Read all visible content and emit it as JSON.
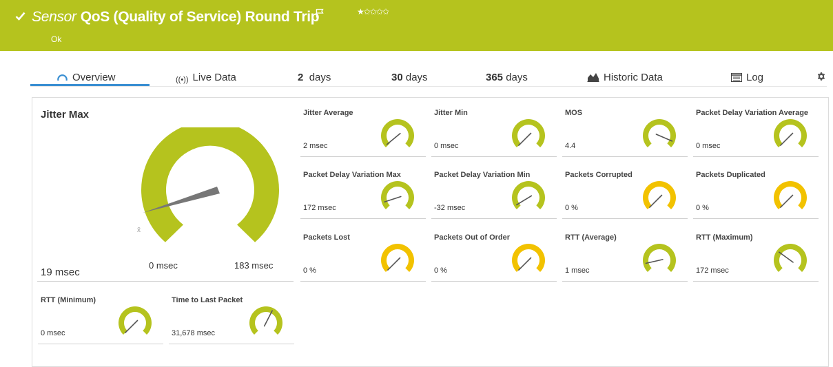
{
  "header": {
    "pre_label": "Sensor",
    "title": "QoS (Quality of Service) Round Trip",
    "status": "Ok",
    "stars": "★✩✩✩✩",
    "check_icon": "check-icon",
    "flag_icon": "flag-icon",
    "colors": {
      "background": "#b5c31e",
      "text": "#ffffff"
    }
  },
  "tabs": [
    {
      "label": "Overview",
      "icon": "gauge-icon"
    },
    {
      "label": "Live Data",
      "icon": "broadcast-icon"
    },
    {
      "number": "2",
      "unit": "days"
    },
    {
      "number": "30",
      "unit": "days"
    },
    {
      "number": "365",
      "unit": "days"
    },
    {
      "label": "Historic Data",
      "icon": "area-chart-icon"
    },
    {
      "label": "Log",
      "icon": "log-icon"
    }
  ],
  "settings_icon": "gear-icon",
  "primary": {
    "name": "Jitter Max",
    "value": "19 msec",
    "min_label": "0 msec",
    "max_label": "183 msec",
    "marker": "x̄",
    "fraction": 0.1
  },
  "channels": [
    {
      "name": "Jitter Average",
      "value": "2 msec",
      "color": "#b5c31e",
      "fraction": 0.02
    },
    {
      "name": "Jitter Min",
      "value": "0 msec",
      "color": "#b5c31e",
      "fraction": 0.0
    },
    {
      "name": "MOS",
      "value": "4.4",
      "color": "#b5c31e",
      "fraction": 0.92
    },
    {
      "name": "Packet Delay Variation Average",
      "value": "0 msec",
      "color": "#b5c31e",
      "fraction": 0.0
    },
    {
      "name": "Packet Delay Variation Max",
      "value": "172 msec",
      "color": "#b5c31e",
      "fraction": 0.1
    },
    {
      "name": "Packet Delay Variation Min",
      "value": "-32 msec",
      "color": "#b5c31e",
      "fraction": 0.05
    },
    {
      "name": "Packets Corrupted",
      "value": "0 %",
      "color": "#f2c200",
      "fraction": 0.0
    },
    {
      "name": "Packets Duplicated",
      "value": "0 %",
      "color": "#f2c200",
      "fraction": 0.0
    },
    {
      "name": "Packets Lost",
      "value": "0 %",
      "color": "#f2c200",
      "fraction": 0.0
    },
    {
      "name": "Packets Out of Order",
      "value": "0 %",
      "color": "#f2c200",
      "fraction": 0.0
    },
    {
      "name": "RTT (Average)",
      "value": "1 msec",
      "color": "#b5c31e",
      "fraction": 0.12
    },
    {
      "name": "RTT (Maximum)",
      "value": "172 msec",
      "color": "#b5c31e",
      "fraction": 0.3
    },
    {
      "name": "RTT (Minimum)",
      "value": "0 msec",
      "color": "#b5c31e",
      "fraction": 0.0
    },
    {
      "name": "Time to Last Packet",
      "value": "31,678 msec",
      "color": "#b5c31e",
      "fraction": 0.6
    }
  ]
}
